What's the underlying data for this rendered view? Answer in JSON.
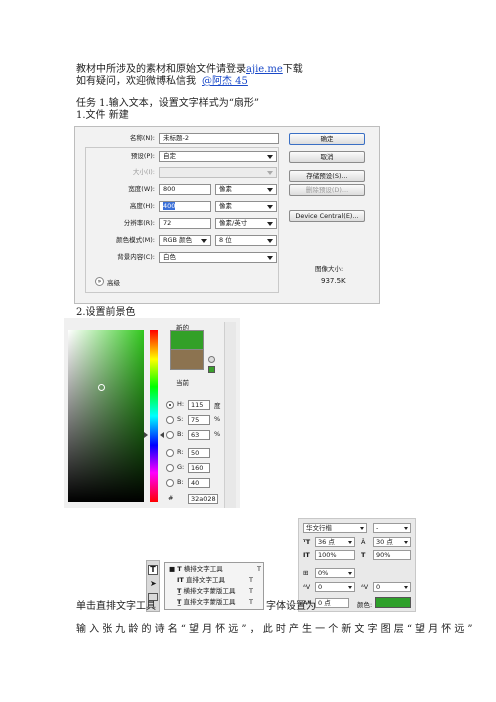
{
  "intro": {
    "line1_pre": "教材中所涉及的素材和原始文件请登录",
    "line1_link": "ajie.me",
    "line1_post": "下载",
    "line2_pre": "如有疑问，欢迎微博私信我",
    "line2_link": "@阿杰 45"
  },
  "task": "任务 1.输入文本，设置文字样式为“扇形”",
  "step1": "1.文件  新建",
  "new_dialog": {
    "name_label": "名称(N):",
    "name_value": "未标题-2",
    "preset_label": "预设(P):",
    "preset_value": "自定",
    "size_label": "大小(I):",
    "width_label": "宽度(W):",
    "width_value": "800",
    "width_unit": "像素",
    "height_label": "高度(H):",
    "height_value": "400",
    "height_unit": "像素",
    "res_label": "分辨率(R):",
    "res_value": "72",
    "res_unit": "像素/英寸",
    "mode_label": "颜色模式(M):",
    "mode_value": "RGB 颜色",
    "bit_value": "8 位",
    "bg_label": "背景内容(C):",
    "bg_value": "白色",
    "advanced": "高级",
    "ok": "确定",
    "cancel": "取消",
    "save_preset": "存储预设(S)...",
    "delete_preset": "删除预设(D)...",
    "device_central": "Device Central(E)...",
    "image_size_label": "图像大小:",
    "image_size_value": "937.5K"
  },
  "step2": "2.设置前景色",
  "color_picker": {
    "new_label": "新的",
    "current_label": "当前",
    "new_color": "#32a028",
    "current_color": "#8c7350",
    "h_label": "H:",
    "h_value": "115",
    "h_unit": "度",
    "s_label": "S:",
    "s_value": "75",
    "s_unit": "%",
    "b_label": "B:",
    "b_value": "63",
    "b_unit": "%",
    "r_label": "R:",
    "r_value": "50",
    "g_label": "G:",
    "g_value": "160",
    "bl_label": "B:",
    "bl_value": "40",
    "hex_label": "#",
    "hex_value": "32a028"
  },
  "char_panel": {
    "font": "华文行楷",
    "style": "-",
    "size": "36 点",
    "leading": "30 点",
    "vscale": "100%",
    "hscale": "90%",
    "tracking_pct": "0%",
    "kerning": "0",
    "tracking": "0",
    "baseline": "0 点",
    "color_label": "颜色:",
    "color": "#2ea02a"
  },
  "tool_flyout": [
    {
      "label": "横排文字工具",
      "key": "T"
    },
    {
      "label": "直排文字工具",
      "key": "T"
    },
    {
      "label": "横排文字蒙版工具",
      "key": "T"
    },
    {
      "label": "直排文字蒙版工具",
      "key": "T"
    }
  ],
  "bottom_line1_pre": "单击直排文字工具",
  "bottom_line1_post": "字体设置为",
  "bottom_line2": "输入张九龄的诗名“望月怀远”，此时产生一个新文字图层“望月怀远”"
}
